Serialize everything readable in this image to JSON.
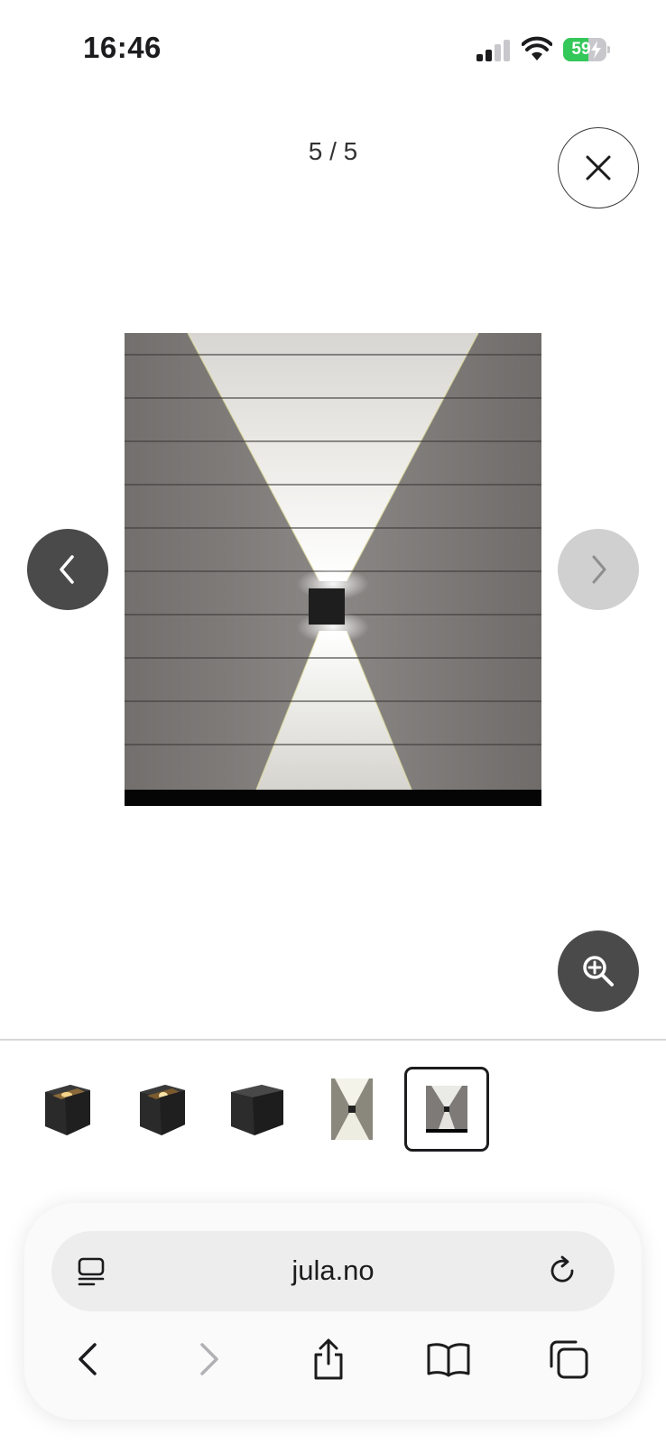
{
  "status_bar": {
    "time": "16:46",
    "battery_percent": "59",
    "battery_level": 0.59,
    "icons": [
      "cellular-signal-icon",
      "wifi-icon",
      "battery-charging-icon"
    ]
  },
  "gallery": {
    "counter": "5 / 5",
    "current_index": 5,
    "total": 5,
    "icons": {
      "close": "close-icon",
      "prev": "chevron-left-icon",
      "next": "chevron-right-icon",
      "zoom": "zoom-in-icon"
    },
    "thumbnails": [
      {
        "index": 1,
        "subject": "black cube wall lamp, lit inside, angled view",
        "selected": false
      },
      {
        "index": 2,
        "subject": "black cube wall lamp, lit inside, angled view",
        "selected": false
      },
      {
        "index": 3,
        "subject": "black cube wall lamp, unlit",
        "selected": false
      },
      {
        "index": 4,
        "subject": "lamp on wall casting up and down light",
        "selected": false
      },
      {
        "index": 5,
        "subject": "lamp on wooden wall casting up and down light",
        "selected": true
      }
    ]
  },
  "browser": {
    "url": "jula.no",
    "icons": {
      "reader": "page-menu-icon",
      "reload": "reload-icon",
      "back": "back-arrow-icon",
      "forward": "forward-arrow-icon",
      "share": "share-icon",
      "bookmarks": "bookmarks-icon",
      "tabs": "tabs-icon"
    },
    "forward_enabled": false
  },
  "colors": {
    "nav_button_active": "#4a4a4a",
    "nav_button_disabled": "#d0d0d0",
    "battery_green": "#34c759",
    "disabled_icon": "#b0b0b5"
  }
}
